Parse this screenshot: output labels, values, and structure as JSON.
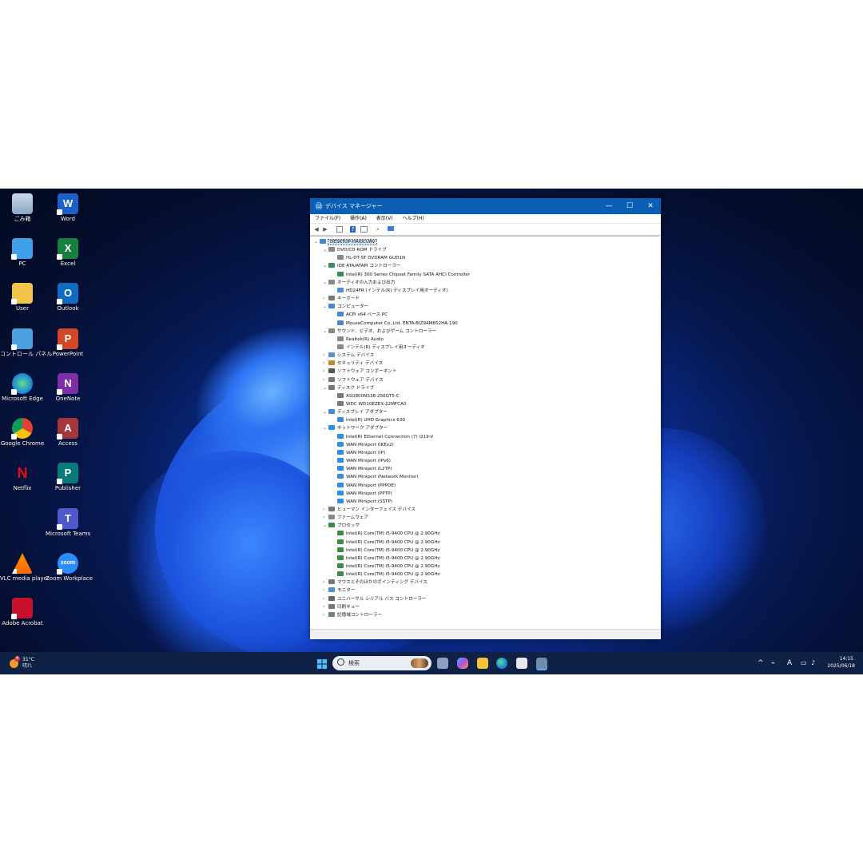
{
  "desktop": {
    "icons": [
      {
        "label": "ごみ箱",
        "icon": "recycle-bin-icon"
      },
      {
        "label": "Word",
        "icon": "word-icon",
        "letter": "W"
      },
      {
        "label": "PC",
        "icon": "pc-icon"
      },
      {
        "label": "Excel",
        "icon": "excel-icon",
        "letter": "X"
      },
      {
        "label": "User",
        "icon": "user-folder-icon"
      },
      {
        "label": "Outlook",
        "icon": "outlook-icon",
        "letter": "O"
      },
      {
        "label": "コントロール パネル",
        "icon": "control-panel-icon"
      },
      {
        "label": "PowerPoint",
        "icon": "powerpoint-icon",
        "letter": "P"
      },
      {
        "label": "Microsoft Edge",
        "icon": "edge-icon"
      },
      {
        "label": "OneNote",
        "icon": "onenote-icon",
        "letter": "N"
      },
      {
        "label": "Google Chrome",
        "icon": "chrome-icon"
      },
      {
        "label": "Access",
        "icon": "access-icon",
        "letter": "A"
      },
      {
        "label": "Netflix",
        "icon": "netflix-icon",
        "letter": "N"
      },
      {
        "label": "Publisher",
        "icon": "publisher-icon",
        "letter": "P"
      },
      {
        "label": "Microsoft Teams",
        "icon": "teams-icon",
        "letter": "T"
      },
      {
        "label": "VLC media player",
        "icon": "vlc-icon"
      },
      {
        "label": "Zoom Workplace",
        "icon": "zoom-icon",
        "letter": "zoom"
      },
      {
        "label": "Adobe Acrobat",
        "icon": "acrobat-icon"
      }
    ]
  },
  "window": {
    "title": "デバイス マネージャー",
    "minimize": "—",
    "maximize": "☐",
    "close": "✕",
    "menu": [
      "ファイル(F)",
      "操作(A)",
      "表示(V)",
      "ヘルプ(H)"
    ],
    "tree": [
      {
        "level": 0,
        "expand": "v",
        "label": "DESKTOP-HAI0CURV",
        "icon": "computer-icon",
        "selected": true
      },
      {
        "level": 1,
        "expand": "v",
        "label": "DVD/CD-ROM ドライブ",
        "icon": "dvd-drive-icon"
      },
      {
        "level": 2,
        "expand": "",
        "label": "HL-DT-ST DVDRAM GUD1N",
        "icon": "dvd-drive-icon"
      },
      {
        "level": 1,
        "expand": "v",
        "label": "IDE ATA/ATAPI コントローラー",
        "icon": "ide-controller-icon"
      },
      {
        "level": 2,
        "expand": "",
        "label": "Intel(R) 300 Series Chipset Family SATA AHCI Controller",
        "icon": "ide-controller-icon"
      },
      {
        "level": 1,
        "expand": "v",
        "label": "オーディオの入力および出力",
        "icon": "audio-icon"
      },
      {
        "level": 2,
        "expand": "",
        "label": "HD24FR (インテル(R) ディスプレイ用オーディオ)",
        "icon": "monitor-icon"
      },
      {
        "level": 1,
        "expand": ">",
        "label": "キーボード",
        "icon": "keyboard-icon"
      },
      {
        "level": 1,
        "expand": "v",
        "label": "コンピューター",
        "icon": "computer-icon"
      },
      {
        "level": 2,
        "expand": "",
        "label": "ACPI x64 ベース PC",
        "icon": "computer-icon"
      },
      {
        "level": 2,
        "expand": "",
        "label": "MouseComputer Co.,Ltd. ENTA-BIZ94M852HA-190",
        "icon": "computer-icon"
      },
      {
        "level": 1,
        "expand": "v",
        "label": "サウンド、ビデオ、およびゲーム コントローラー",
        "icon": "audio-icon"
      },
      {
        "level": 2,
        "expand": "",
        "label": "Realtek(R) Audio",
        "icon": "audio-icon"
      },
      {
        "level": 2,
        "expand": "",
        "label": "インテル(R) ディスプレイ用オーディオ",
        "icon": "audio-icon"
      },
      {
        "level": 1,
        "expand": ">",
        "label": "システム デバイス",
        "icon": "system-folder-icon"
      },
      {
        "level": 1,
        "expand": ">",
        "label": "セキュリティ デバイス",
        "icon": "security-icon"
      },
      {
        "level": 1,
        "expand": ">",
        "label": "ソフトウェア コンポーネント",
        "icon": "software-component-icon"
      },
      {
        "level": 1,
        "expand": ">",
        "label": "ソフトウェア デバイス",
        "icon": "software-device-icon"
      },
      {
        "level": 1,
        "expand": "v",
        "label": "ディスク ドライブ",
        "icon": "disk-drive-icon"
      },
      {
        "level": 2,
        "expand": "",
        "label": "ASU800NS38-256GT5-C",
        "icon": "disk-drive-icon"
      },
      {
        "level": 2,
        "expand": "",
        "label": "WDC WD10EZEX-22MFCA0",
        "icon": "disk-drive-icon"
      },
      {
        "level": 1,
        "expand": "v",
        "label": "ディスプレイ アダプター",
        "icon": "display-adapter-icon"
      },
      {
        "level": 2,
        "expand": "",
        "label": "Intel(R) UHD Graphics 630",
        "icon": "display-adapter-icon"
      },
      {
        "level": 1,
        "expand": "v",
        "label": "ネットワーク アダプター",
        "icon": "network-adapter-icon"
      },
      {
        "level": 2,
        "expand": "",
        "label": "Intel(R) Ethernet Connection (7) I219-V",
        "icon": "network-adapter-icon"
      },
      {
        "level": 2,
        "expand": "",
        "label": "WAN Miniport (IKEv2)",
        "icon": "network-adapter-icon"
      },
      {
        "level": 2,
        "expand": "",
        "label": "WAN Miniport (IP)",
        "icon": "network-adapter-icon"
      },
      {
        "level": 2,
        "expand": "",
        "label": "WAN Miniport (IPv6)",
        "icon": "network-adapter-icon"
      },
      {
        "level": 2,
        "expand": "",
        "label": "WAN Miniport (L2TP)",
        "icon": "network-adapter-icon"
      },
      {
        "level": 2,
        "expand": "",
        "label": "WAN Miniport (Network Monitor)",
        "icon": "network-adapter-icon"
      },
      {
        "level": 2,
        "expand": "",
        "label": "WAN Miniport (PPPOE)",
        "icon": "network-adapter-icon"
      },
      {
        "level": 2,
        "expand": "",
        "label": "WAN Miniport (PPTP)",
        "icon": "network-adapter-icon"
      },
      {
        "level": 2,
        "expand": "",
        "label": "WAN Miniport (SSTP)",
        "icon": "network-adapter-icon"
      },
      {
        "level": 1,
        "expand": ">",
        "label": "ヒューマン インターフェイス デバイス",
        "icon": "hid-icon"
      },
      {
        "level": 1,
        "expand": ">",
        "label": "ファームウェア",
        "icon": "firmware-icon"
      },
      {
        "level": 1,
        "expand": "v",
        "label": "プロセッサ",
        "icon": "processor-icon"
      },
      {
        "level": 2,
        "expand": "",
        "label": "Intel(R) Core(TM) i5-9400 CPU @ 2.90GHz",
        "icon": "processor-icon"
      },
      {
        "level": 2,
        "expand": "",
        "label": "Intel(R) Core(TM) i5-9400 CPU @ 2.90GHz",
        "icon": "processor-icon"
      },
      {
        "level": 2,
        "expand": "",
        "label": "Intel(R) Core(TM) i5-9400 CPU @ 2.90GHz",
        "icon": "processor-icon"
      },
      {
        "level": 2,
        "expand": "",
        "label": "Intel(R) Core(TM) i5-9400 CPU @ 2.90GHz",
        "icon": "processor-icon"
      },
      {
        "level": 2,
        "expand": "",
        "label": "Intel(R) Core(TM) i5-9400 CPU @ 2.90GHz",
        "icon": "processor-icon"
      },
      {
        "level": 2,
        "expand": "",
        "label": "Intel(R) Core(TM) i5-9400 CPU @ 2.90GHz",
        "icon": "processor-icon"
      },
      {
        "level": 1,
        "expand": ">",
        "label": "マウスとそのほかのポインティング デバイス",
        "icon": "mouse-icon"
      },
      {
        "level": 1,
        "expand": ">",
        "label": "モニター",
        "icon": "monitor-icon"
      },
      {
        "level": 1,
        "expand": ">",
        "label": "ユニバーサル シリアル バス コントローラー",
        "icon": "usb-icon"
      },
      {
        "level": 1,
        "expand": ">",
        "label": "印刷キュー",
        "icon": "printer-icon"
      },
      {
        "level": 1,
        "expand": ">",
        "label": "記憶域コントローラー",
        "icon": "storage-controller-icon"
      }
    ]
  },
  "taskbar": {
    "weather_temp": "31°C",
    "weather_desc": "晴れ",
    "weather_badge": "4",
    "search_placeholder": "検索",
    "ime": "A",
    "time": "14:15",
    "date": "2025/06/18",
    "colors": {
      "bar": "#0f2144",
      "accent": "#0a5fb4"
    }
  }
}
